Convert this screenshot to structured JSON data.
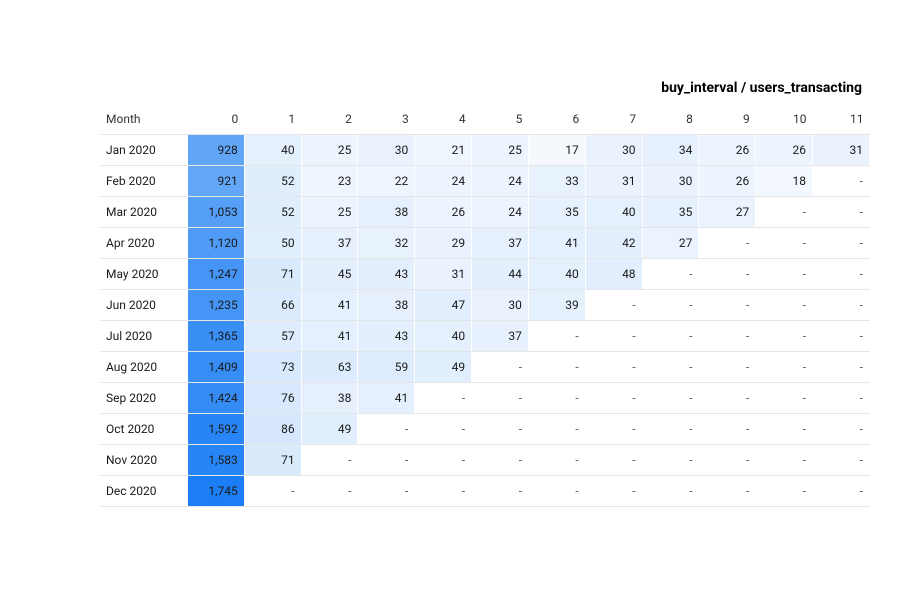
{
  "title": "buy_interval / users_transacting",
  "row_header_label": "Month",
  "empty_placeholder": "-",
  "intervals": [
    0,
    1,
    2,
    3,
    4,
    5,
    6,
    7,
    8,
    9,
    10,
    11
  ],
  "months": [
    "Jan 2020",
    "Feb 2020",
    "Mar 2020",
    "Apr 2020",
    "May 2020",
    "Jun 2020",
    "Jul 2020",
    "Aug 2020",
    "Sep 2020",
    "Oct 2020",
    "Nov 2020",
    "Dec 2020"
  ],
  "colors": {
    "scale_low": "#f5f9fe",
    "scale_high": "#1c7ef4",
    "scale_text_light": "#ffffff",
    "scale_text_dark": "#1a1a1a"
  },
  "chart_data": {
    "type": "heatmap",
    "title": "buy_interval / users_transacting",
    "xlabel": "buy_interval",
    "ylabel": "Month",
    "x": [
      0,
      1,
      2,
      3,
      4,
      5,
      6,
      7,
      8,
      9,
      10,
      11
    ],
    "y": [
      "Jan 2020",
      "Feb 2020",
      "Mar 2020",
      "Apr 2020",
      "May 2020",
      "Jun 2020",
      "Jul 2020",
      "Aug 2020",
      "Sep 2020",
      "Oct 2020",
      "Nov 2020",
      "Dec 2020"
    ],
    "values": [
      [
        928,
        40,
        25,
        30,
        21,
        25,
        17,
        30,
        34,
        26,
        26,
        31
      ],
      [
        921,
        52,
        23,
        22,
        24,
        24,
        33,
        31,
        30,
        26,
        18,
        null
      ],
      [
        1053,
        52,
        25,
        38,
        26,
        24,
        35,
        40,
        35,
        27,
        null,
        null
      ],
      [
        1120,
        50,
        37,
        32,
        29,
        37,
        41,
        42,
        27,
        null,
        null,
        null
      ],
      [
        1247,
        71,
        45,
        43,
        31,
        44,
        40,
        48,
        null,
        null,
        null,
        null
      ],
      [
        1235,
        66,
        41,
        38,
        47,
        30,
        39,
        null,
        null,
        null,
        null,
        null
      ],
      [
        1365,
        57,
        41,
        43,
        40,
        37,
        null,
        null,
        null,
        null,
        null,
        null
      ],
      [
        1409,
        73,
        63,
        59,
        49,
        null,
        null,
        null,
        null,
        null,
        null,
        null
      ],
      [
        1424,
        76,
        38,
        41,
        null,
        null,
        null,
        null,
        null,
        null,
        null,
        null
      ],
      [
        1592,
        86,
        49,
        null,
        null,
        null,
        null,
        null,
        null,
        null,
        null,
        null
      ],
      [
        1583,
        71,
        null,
        null,
        null,
        null,
        null,
        null,
        null,
        null,
        null,
        null
      ],
      [
        1745,
        null,
        null,
        null,
        null,
        null,
        null,
        null,
        null,
        null,
        null,
        null
      ]
    ]
  }
}
